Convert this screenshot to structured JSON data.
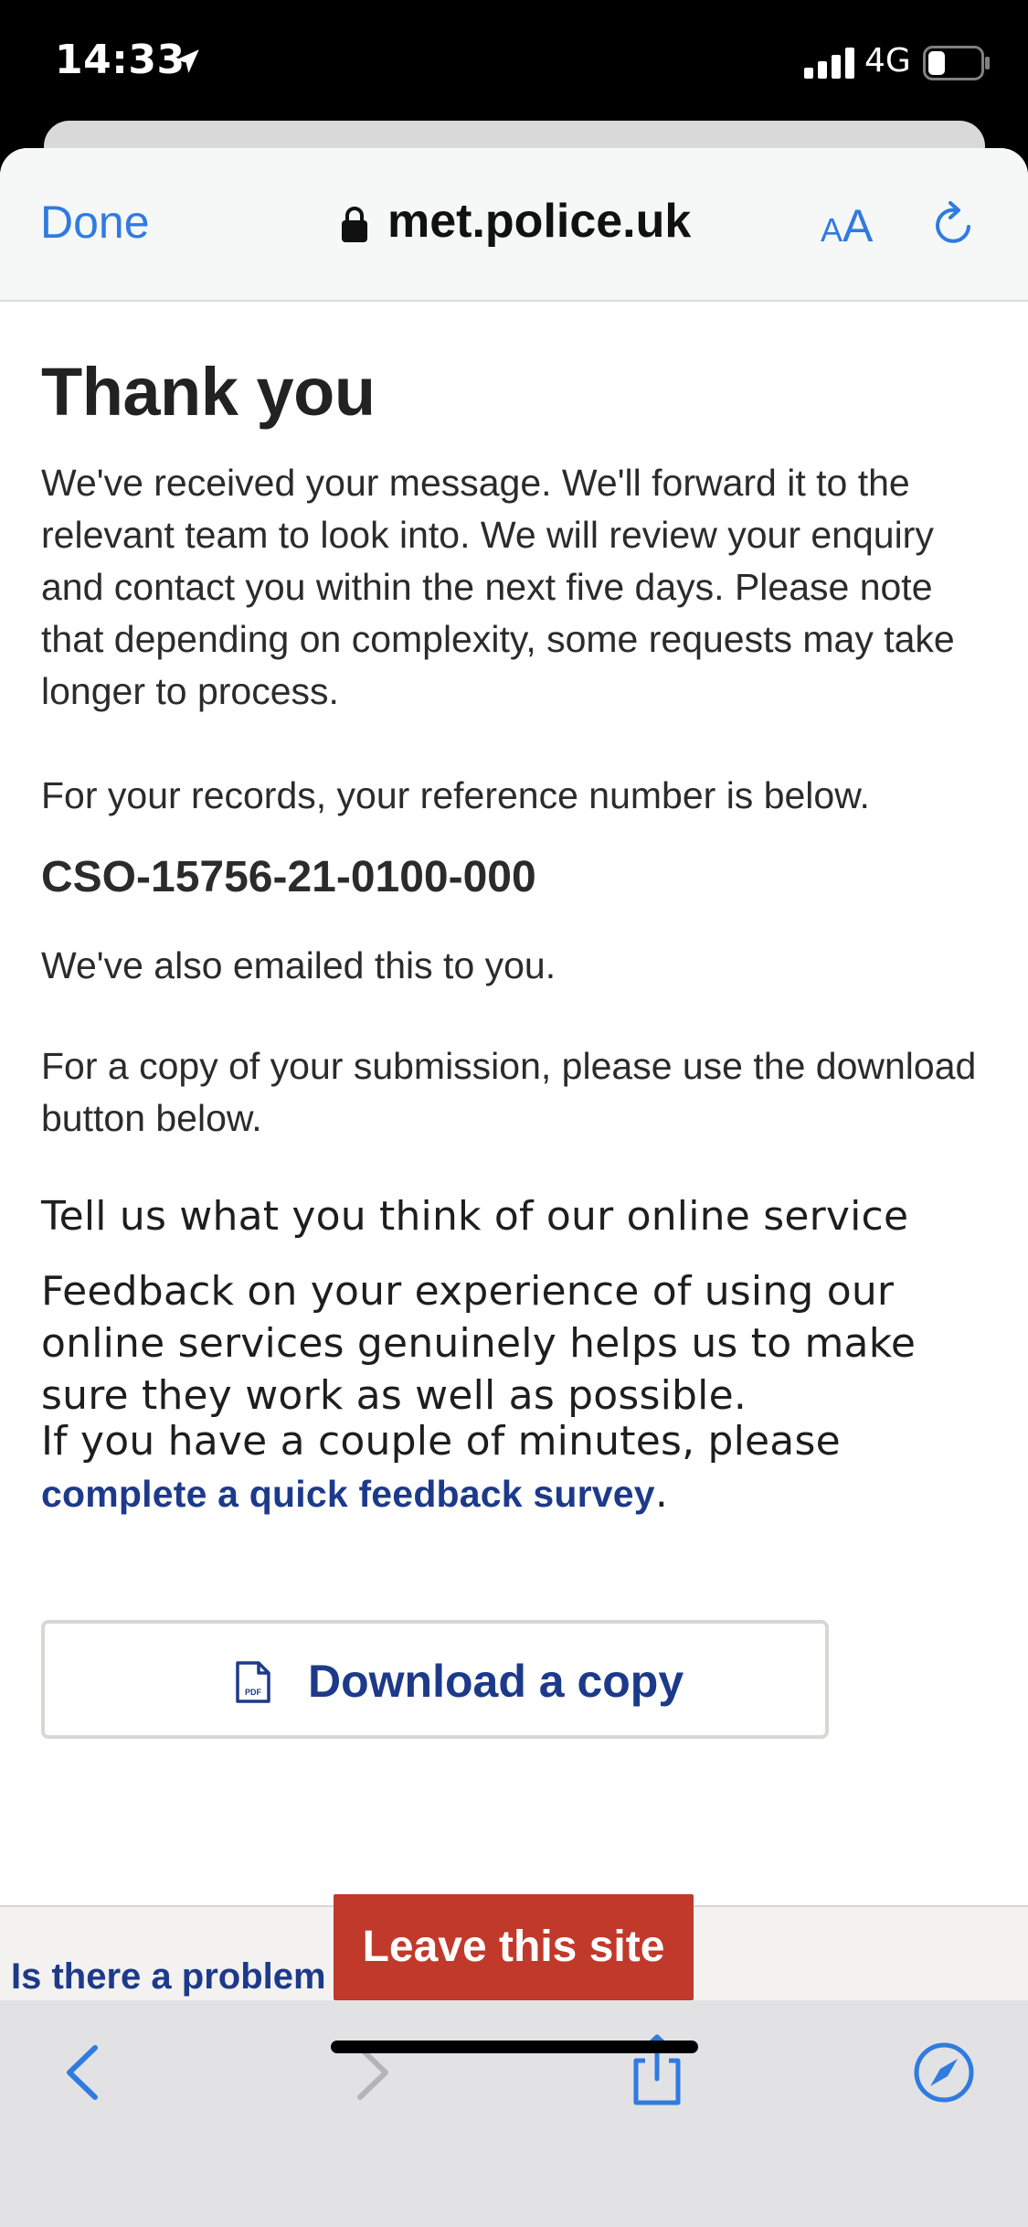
{
  "status_bar": {
    "time": "14:33",
    "network": "4G"
  },
  "nav": {
    "done_label": "Done",
    "url": "met.police.uk",
    "aa_small": "A",
    "aa_big": "A"
  },
  "page": {
    "title": "Thank you",
    "intro": "We've received your message. We'll forward it to the relevant team to look into. We will review your enquiry and contact you within the next five days. Please note that depending on complexity, some requests may take longer to process.",
    "records_text": "For your records, your reference number is below.",
    "reference_number": "CSO-15756-21-0100-000",
    "emailed_text": "We've also emailed this to you.",
    "copy_text": "For a copy of your submission, please use the download button below.",
    "feedback_heading": "Tell us what you think of our online service",
    "feedback_body": "Feedback on your experience of using our online services genuinely helps us to make sure they work as well as possible.",
    "feedback_prompt": "If you have a couple of minutes, please ",
    "feedback_link": "complete a quick feedback survey",
    "feedback_end": ".",
    "download_label": "Download a copy",
    "pdf_icon_text": "PDF"
  },
  "footer": {
    "problem_link": "Is there a problem with this page?",
    "leave_label": "Leave this site"
  },
  "colors": {
    "ios_blue": "#2f7be0",
    "link_navy": "#1d3a8a",
    "leave_red": "#c1392b"
  },
  "icons": [
    "location-arrow-icon",
    "signal-icon",
    "battery-icon",
    "lock-icon",
    "reload-icon",
    "pdf-icon",
    "back-icon",
    "forward-icon",
    "share-icon",
    "compass-icon"
  ]
}
